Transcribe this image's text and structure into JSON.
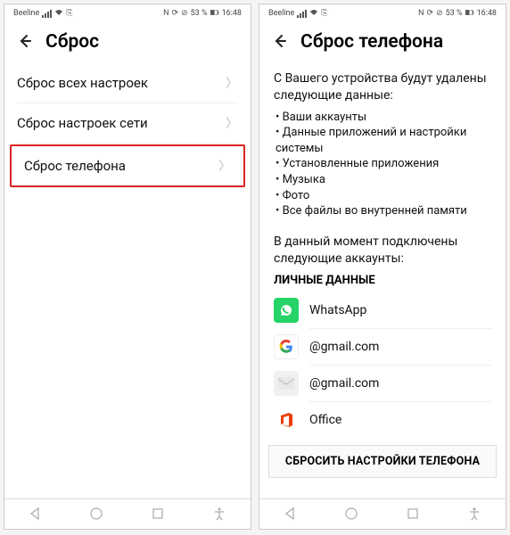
{
  "status": {
    "carrier": "Beeline",
    "battery": "53 %",
    "time": "16:48",
    "nfc": "N",
    "alarm": "⊘"
  },
  "left": {
    "title": "Сброс",
    "items": [
      {
        "label": "Сброс всех настроек",
        "highlight": false
      },
      {
        "label": "Сброс настроек сети",
        "highlight": false
      },
      {
        "label": "Сброс телефона",
        "highlight": true
      }
    ]
  },
  "right": {
    "title": "Сброс телефона",
    "intro": "С Вашего устройства будут удалены следующие данные:",
    "bullets": [
      "Ваши аккаунты",
      "Данные приложений и настройки системы",
      "Установленные приложения",
      "Музыка",
      "Фото",
      "Все файлы во внутренней памяти"
    ],
    "accountsIntro": "В данный момент подключены следующие аккаунты:",
    "sectionTitle": "ЛИЧНЫЕ ДАННЫЕ",
    "accounts": [
      {
        "icon": "whatsapp-icon",
        "label": "WhatsApp"
      },
      {
        "icon": "google-icon",
        "label": "@gmail.com"
      },
      {
        "icon": "mail-icon",
        "label": "@gmail.com"
      },
      {
        "icon": "office-icon",
        "label": "Office"
      }
    ],
    "buttonLabel": "СБРОСИТЬ НАСТРОЙКИ ТЕЛЕФОНА"
  }
}
